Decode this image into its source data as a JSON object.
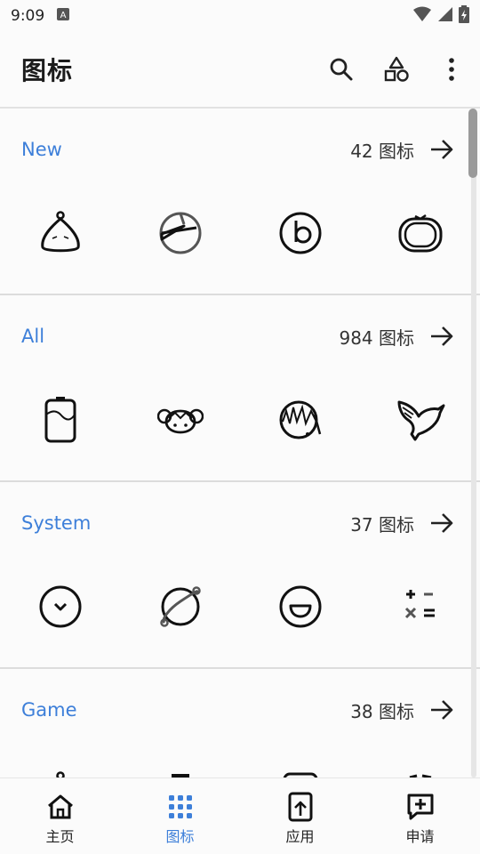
{
  "status": {
    "time": "9:09"
  },
  "app_bar": {
    "title": "图标",
    "icons": [
      "search-icon",
      "shapes-icon",
      "more-vert-icon"
    ]
  },
  "sections": [
    {
      "name": "New",
      "count": "42 图标",
      "icons": [
        "sack-icon",
        "pie-clock-icon",
        "beats-icon",
        "tomato-icon"
      ]
    },
    {
      "name": "All",
      "count": "984 图标",
      "icons": [
        "battery-icon",
        "bun-girl-icon",
        "hair-girl-icon",
        "dove-icon"
      ]
    },
    {
      "name": "System",
      "count": "37 图标",
      "icons": [
        "clock-chevron-icon",
        "planet-icon",
        "smile-icon",
        "calculator-icon"
      ]
    },
    {
      "name": "Game",
      "count": "38 图标",
      "icons": [
        "game-1-icon",
        "game-2-icon",
        "game-3-icon",
        "game-4-icon"
      ]
    }
  ],
  "bottom_nav": [
    {
      "label": "主页",
      "icon": "home-icon",
      "active": false
    },
    {
      "label": "图标",
      "icon": "grid-icon",
      "active": true
    },
    {
      "label": "应用",
      "icon": "app-upload-icon",
      "active": false
    },
    {
      "label": "申请",
      "icon": "request-add-icon",
      "active": false
    }
  ],
  "colors": {
    "accent": "#3d7fd9",
    "text": "#1c1c1c",
    "background": "#fbfbfb"
  }
}
